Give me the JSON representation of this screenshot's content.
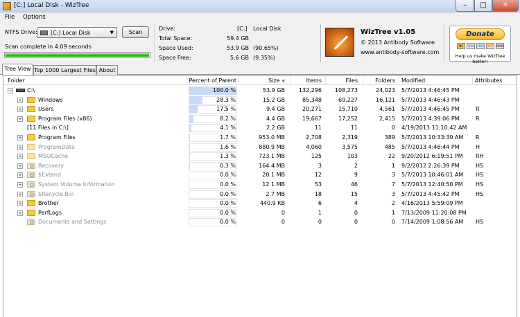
{
  "window": {
    "title": "[C:] Local Disk  - WizTree"
  },
  "menu": {
    "file": "File",
    "options": "Options"
  },
  "left_panel": {
    "ntfs_label": "NTFS Drive:",
    "drive_select": "[C:] Local Disk",
    "scan_button": "Scan",
    "status": "Scan complete in 4.09 seconds",
    "progress_fraction": 1.0
  },
  "drive_info": {
    "drive_label": "Drive:",
    "drive_value": "[C:]",
    "drive_name": "Local Disk",
    "total_label": "Total Space:",
    "total_value": "59.4 GB",
    "used_label": "Space Used:",
    "used_value": "53.9 GB",
    "used_pct": "(90.65%)",
    "free_label": "Space Free:",
    "free_value": "5.6 GB",
    "free_pct": "(9.35%)"
  },
  "about": {
    "name": "WizTree v1.05",
    "copyright": "© 2013 Antibody Software",
    "url": "www.antibody-software.com"
  },
  "donate": {
    "label": "Donate",
    "cards": [
      "MC",
      "VISA",
      "AMEX",
      "DISC",
      "BANK"
    ],
    "help": "Help us make WizTree better!"
  },
  "tabs": [
    "Tree View",
    "Top 1000 Largest Files",
    "About"
  ],
  "columns": {
    "folder": "Folder",
    "percent": "Percent of Parent",
    "size": "Size",
    "items": "Items",
    "files": "Files",
    "folders": "Folders",
    "modified": "Modified",
    "attributes": "Attributes"
  },
  "rows": [
    {
      "name": "C:\\",
      "pct": "100.0 %",
      "pct_value": 100.0,
      "size": "53.9 GB",
      "items": "132,296",
      "files": "108,273",
      "folders": "24,023",
      "modified": "5/7/2013 4:46:45 PM",
      "attr": "",
      "icon": "drive-icon",
      "expander": "⊟",
      "style": "normal"
    },
    {
      "name": "Windows",
      "pct": "28.3 %",
      "pct_value": 28.3,
      "size": "15.2 GB",
      "items": "85,348",
      "files": "69,227",
      "folders": "16,121",
      "modified": "5/7/2013 4:46:43 PM",
      "attr": "",
      "icon": "folder-icon",
      "expander": "⊞",
      "style": "normal"
    },
    {
      "name": "Users",
      "pct": "17.5 %",
      "pct_value": 17.5,
      "size": "9.4 GB",
      "items": "20,271",
      "files": "15,710",
      "folders": "4,561",
      "modified": "5/7/2013 4:46:45 PM",
      "attr": "R",
      "icon": "folder-icon",
      "expander": "⊞",
      "style": "normal"
    },
    {
      "name": "Program Files (x86)",
      "pct": "8.2 %",
      "pct_value": 8.2,
      "size": "4.4 GB",
      "items": "19,667",
      "files": "17,252",
      "folders": "2,415",
      "modified": "5/7/2013 4:39:06 PM",
      "attr": "R",
      "icon": "folder-icon",
      "expander": "⊞",
      "style": "normal"
    },
    {
      "name": "[11 Files in C:\\]",
      "pct": "4.1 %",
      "pct_value": 4.1,
      "size": "2.2 GB",
      "items": "11",
      "files": "11",
      "folders": "0",
      "modified": "4/19/2013 11:10:42 AM",
      "attr": "",
      "icon": "",
      "expander": "",
      "style": "normal"
    },
    {
      "name": "Program Files",
      "pct": "1.7 %",
      "pct_value": 1.7,
      "size": "953.0 MB",
      "items": "2,708",
      "files": "2,319",
      "folders": "389",
      "modified": "5/7/2013 10:33:30 AM",
      "attr": "R",
      "icon": "folder-icon",
      "expander": "⊞",
      "style": "normal"
    },
    {
      "name": "ProgramData",
      "pct": "1.6 %",
      "pct_value": 1.6,
      "size": "880.9 MB",
      "items": "4,060",
      "files": "3,575",
      "folders": "485",
      "modified": "5/7/2013 4:46:44 PM",
      "attr": "H",
      "icon": "folder-icon",
      "expander": "⊞",
      "style": "dim"
    },
    {
      "name": "MSOCache",
      "pct": "1.3 %",
      "pct_value": 1.3,
      "size": "723.1 MB",
      "items": "125",
      "files": "103",
      "folders": "22",
      "modified": "9/20/2012 6:19:51 PM",
      "attr": "RH",
      "icon": "folder-icon",
      "expander": "⊞",
      "style": "dim"
    },
    {
      "name": "Recovery",
      "pct": "0.3 %",
      "pct_value": 0.3,
      "size": "164.4 MB",
      "items": "3",
      "files": "2",
      "folders": "1",
      "modified": "9/2/2012 2:26:39 PM",
      "attr": "HS",
      "icon": "system-folder-icon",
      "expander": "⊞",
      "style": "sys"
    },
    {
      "name": "$Extend",
      "pct": "0.0 %",
      "pct_value": 0.0,
      "size": "20.1 MB",
      "items": "12",
      "files": "9",
      "folders": "3",
      "modified": "5/7/2013 10:46:01 AM",
      "attr": "HS",
      "icon": "system-folder-icon",
      "expander": "⊞",
      "style": "sys"
    },
    {
      "name": "System Volume Information",
      "pct": "0.0 %",
      "pct_value": 0.0,
      "size": "12.1 MB",
      "items": "53",
      "files": "46",
      "folders": "7",
      "modified": "5/7/2013 12:40:50 PM",
      "attr": "HS",
      "icon": "system-folder-icon",
      "expander": "⊞",
      "style": "sys"
    },
    {
      "name": "$Recycle.Bin",
      "pct": "0.0 %",
      "pct_value": 0.0,
      "size": "2.7 MB",
      "items": "18",
      "files": "15",
      "folders": "3",
      "modified": "5/7/2013 4:45:42 PM",
      "attr": "HS",
      "icon": "system-folder-icon",
      "expander": "⊞",
      "style": "sys"
    },
    {
      "name": "Brother",
      "pct": "0.0 %",
      "pct_value": 0.0,
      "size": "440.9 KB",
      "items": "6",
      "files": "4",
      "folders": "2",
      "modified": "4/16/2013 5:59:09 PM",
      "attr": "",
      "icon": "folder-icon",
      "expander": "⊞",
      "style": "normal"
    },
    {
      "name": "PerfLogs",
      "pct": "0.0 %",
      "pct_value": 0.0,
      "size": "0",
      "items": "1",
      "files": "0",
      "folders": "1",
      "modified": "7/13/2009 11:20:08 PM",
      "attr": "",
      "icon": "folder-icon",
      "expander": "⊞",
      "style": "normal"
    },
    {
      "name": "Documents and Settings",
      "pct": "0.0 %",
      "pct_value": 0.0,
      "size": "0",
      "items": "0",
      "files": "0",
      "folders": "0",
      "modified": "7/14/2009 1:08:56 AM",
      "attr": "HS",
      "icon": "system-folder-icon",
      "expander": "",
      "style": "sys"
    }
  ]
}
